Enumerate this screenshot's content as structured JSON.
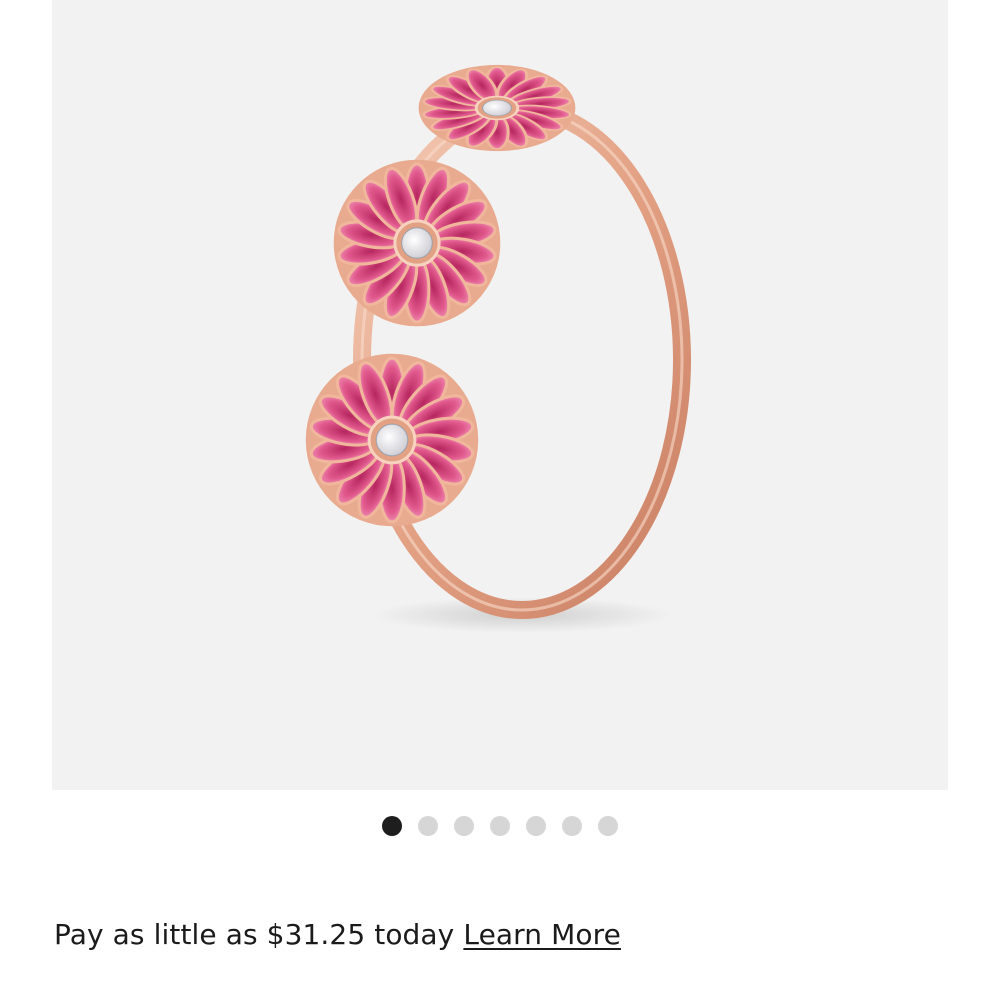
{
  "gallery": {
    "image_subject": "rose gold ring with three pink daisy flowers",
    "next_icon": "chevron-right-icon",
    "dots": [
      {
        "active": true
      },
      {
        "active": false
      },
      {
        "active": false
      },
      {
        "active": false
      },
      {
        "active": false
      },
      {
        "active": false
      },
      {
        "active": false
      }
    ]
  },
  "payment": {
    "text": "Pay as little as $31.25 today",
    "link_label": "Learn More"
  },
  "colors": {
    "image_background": "#f2f2f2",
    "active_dot": "#1e1e1e",
    "inactive_dot": "#d6d6d6",
    "rose_gold": "#e8a88c",
    "petal_pink": "#d94e83"
  }
}
